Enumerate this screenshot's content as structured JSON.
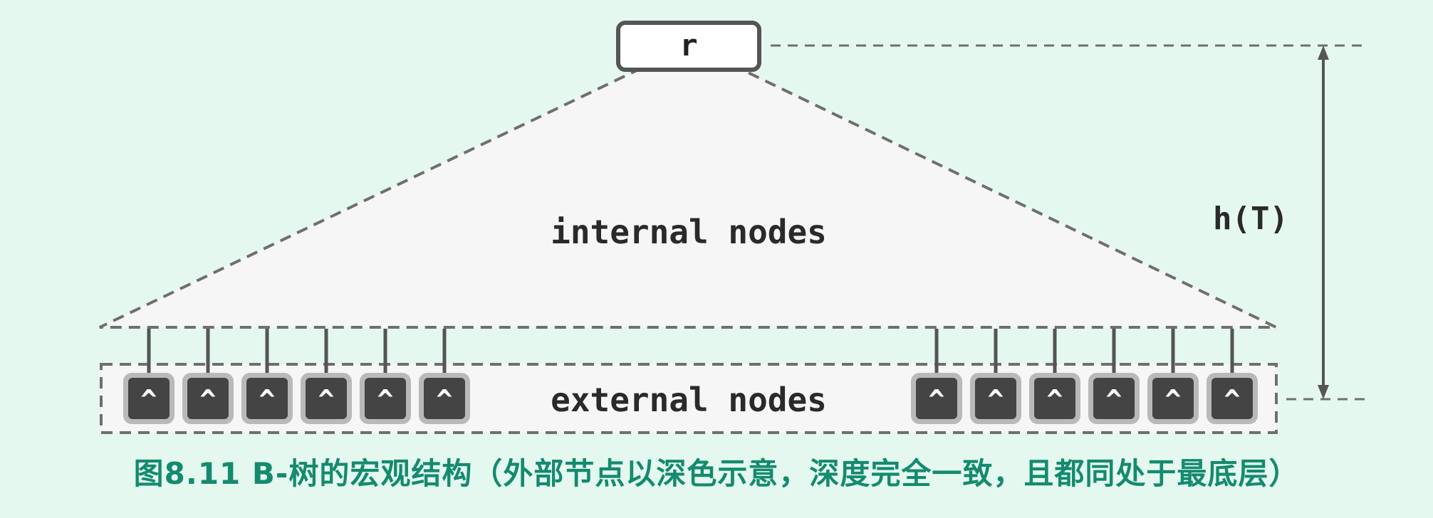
{
  "root": {
    "label": "r"
  },
  "internal": {
    "label": "internal nodes"
  },
  "external": {
    "label": "external nodes",
    "node_symbol": "^",
    "left_group_count": 6,
    "right_group_count": 6
  },
  "height": {
    "label": "h(T)"
  },
  "caption": {
    "text": "图8.11 B-树的宏观结构（外部节点以深色示意，深度完全一致，且都同处于最底层）"
  },
  "colors": {
    "background": "#e4f8ef",
    "region_fill": "#f6f6f6",
    "dashed_line": "#6f6f6f",
    "node_fill": "#444444",
    "node_halo": "#b9b9b9",
    "caption": "#148a6e",
    "text": "#2a2a2a"
  }
}
